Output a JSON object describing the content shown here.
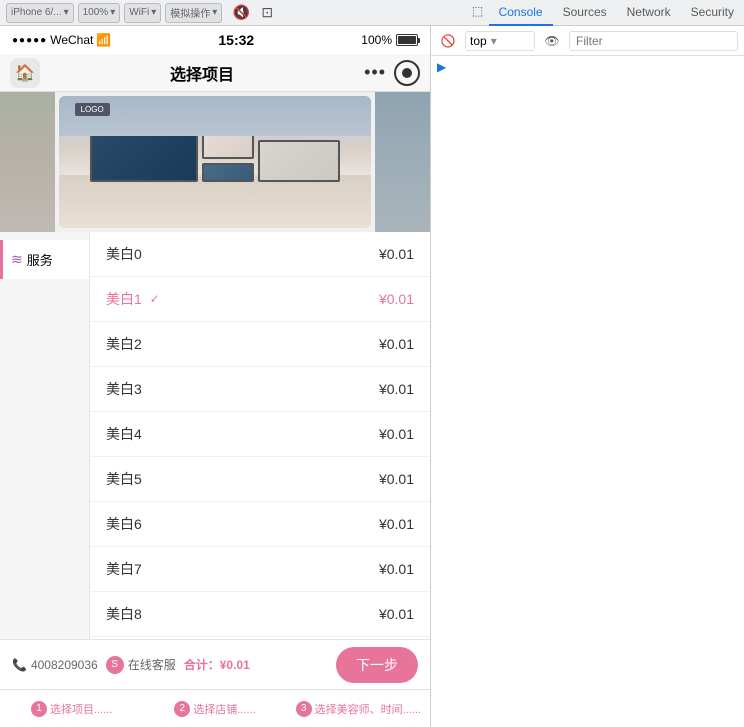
{
  "toolbar": {
    "device_label": "iPhone 6/...",
    "zoom_label": "100%",
    "network_label": "WiFi",
    "action_label": "模拟操作",
    "tabs": {
      "console": "Console",
      "sources": "Sources",
      "network": "Network",
      "security": "Security"
    },
    "console_filter_placeholder": "Filter"
  },
  "phone": {
    "signal": "●●●●●",
    "app_name": "WeChat",
    "wifi_icon": "▾",
    "time": "15:32",
    "battery_pct": "100%",
    "nav_title": "选择项目",
    "phone_number": "4008209036",
    "service_label": "在线客服",
    "total_label": "合计：",
    "total_price": "¥0.01",
    "next_btn": "下一步"
  },
  "devtools": {
    "context_select": "top",
    "filter_placeholder": "Filter"
  },
  "sidebar": {
    "items": [
      {
        "id": "services",
        "label": "服务",
        "icon": "≋",
        "active": true
      }
    ]
  },
  "service_list": {
    "items": [
      {
        "name": "美白0",
        "price": "¥0.01",
        "selected": false
      },
      {
        "name": "美白1",
        "price": "¥0.01",
        "selected": true
      },
      {
        "name": "美白2",
        "price": "¥0.01",
        "selected": false
      },
      {
        "name": "美白3",
        "price": "¥0.01",
        "selected": false
      },
      {
        "name": "美白4",
        "price": "¥0.01",
        "selected": false
      },
      {
        "name": "美白5",
        "price": "¥0.01",
        "selected": false
      },
      {
        "name": "美白6",
        "price": "¥0.01",
        "selected": false
      },
      {
        "name": "美白7",
        "price": "¥0.01",
        "selected": false
      },
      {
        "name": "美白8",
        "price": "¥0.01",
        "selected": false
      }
    ]
  },
  "steps": [
    {
      "num": "1",
      "label": "选择项目......"
    },
    {
      "num": "2",
      "label": "选择店铺......"
    },
    {
      "num": "3",
      "label": "选择美容师、时间......"
    }
  ]
}
